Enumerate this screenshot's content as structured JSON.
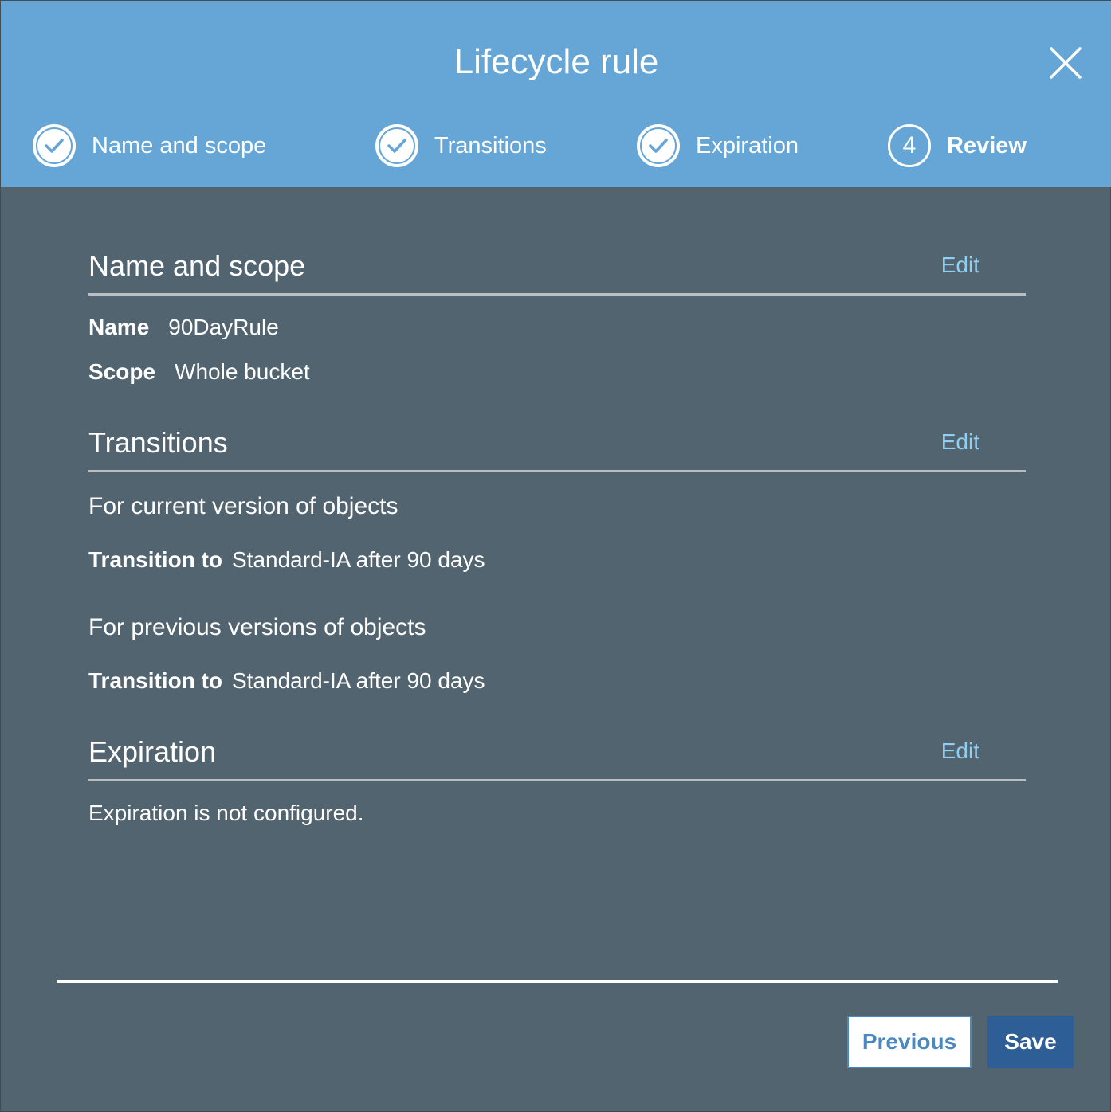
{
  "dialog": {
    "title": "Lifecycle rule",
    "close_icon": "close-icon"
  },
  "steps": [
    {
      "label": "Name and scope",
      "state": "complete",
      "icon": "check-circle-icon"
    },
    {
      "label": "Transitions",
      "state": "complete",
      "icon": "check-circle-icon"
    },
    {
      "label": "Expiration",
      "state": "complete",
      "icon": "check-circle-icon"
    },
    {
      "label": "Review",
      "state": "current",
      "number": "4"
    }
  ],
  "name_scope": {
    "heading": "Name and scope",
    "edit": "Edit",
    "name_label": "Name",
    "name_value": "90DayRule",
    "scope_label": "Scope",
    "scope_value": "Whole bucket"
  },
  "transitions": {
    "heading": "Transitions",
    "edit": "Edit",
    "current_heading": "For current version of objects",
    "current_label": "Transition to",
    "current_value": "Standard-IA after 90 days",
    "previous_heading": "For previous versions of objects",
    "previous_label": "Transition to",
    "previous_value": "Standard-IA after 90 days"
  },
  "expiration": {
    "heading": "Expiration",
    "edit": "Edit",
    "message": "Expiration is not configured."
  },
  "footer": {
    "previous_label": "Previous",
    "save_label": "Save"
  },
  "colors": {
    "header_bg": "#65a6d6",
    "body_bg": "#52646f",
    "link": "#8fd0f2",
    "primary_button": "#2e5e96"
  }
}
